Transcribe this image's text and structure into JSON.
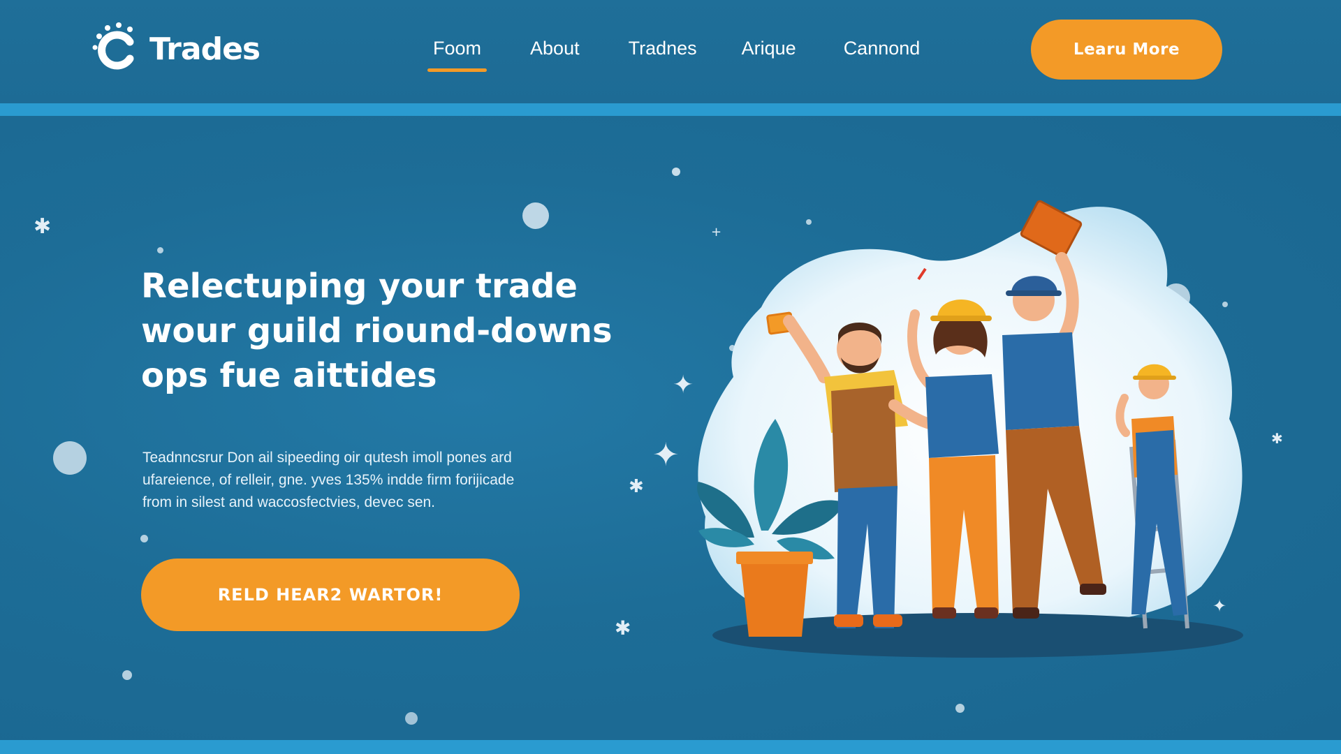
{
  "brand": {
    "name": "Trades",
    "logo_icon": "sun-c-icon"
  },
  "nav": {
    "items": [
      {
        "label": "Foom",
        "active": true
      },
      {
        "label": "About",
        "active": false
      },
      {
        "label": "Tradnes",
        "active": false
      },
      {
        "label": "Arique",
        "active": false
      },
      {
        "label": "Cannond",
        "active": false
      }
    ],
    "cta_label": "Learu More"
  },
  "hero": {
    "headline_lines": [
      "Relectuping your trade",
      "wour guild riound-downs",
      "ops fue aittides"
    ],
    "body_lines": [
      "Teadnncsrur Don ail sipeeding oir qutesh imoll pones ard",
      "ufareience, of relleir, gne. yves 135% indde firm forijicade",
      "from in silest and waccosfectvies, devec sen."
    ],
    "cta_label": "RELD HEAR2 WARTOR!"
  },
  "colors": {
    "header_bg": "#1f6f99",
    "hero_bg": "#1d6d97",
    "accent": "#f39a27",
    "stripe": "#2a9bd0"
  },
  "illustration": {
    "subject": "team-of-tradespeople-illustration"
  }
}
